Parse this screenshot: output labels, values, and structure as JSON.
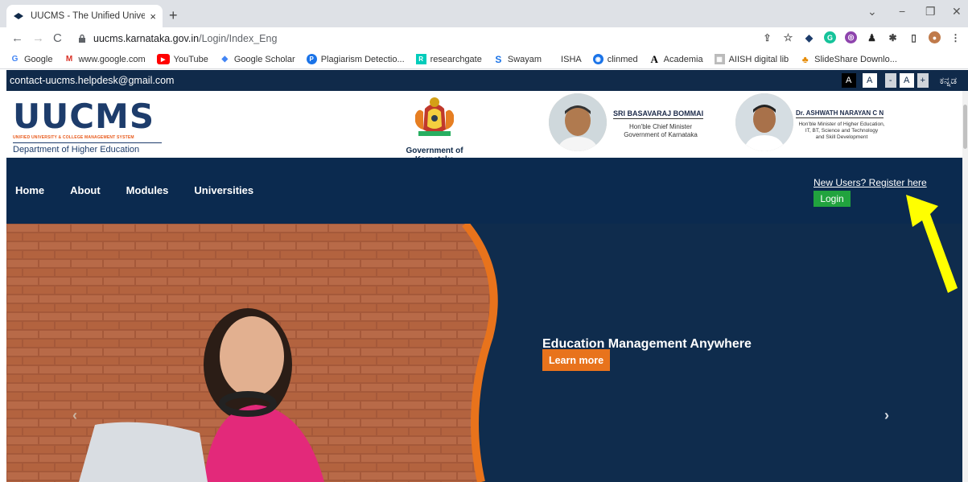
{
  "browser": {
    "tab_title": "UUCMS - The Unified University",
    "tab_close": "×",
    "new_tab": "+",
    "url_host": "uucms.karnataka.gov.in",
    "url_path": "/Login/Index_Eng",
    "bookmarks": [
      {
        "label": "Google",
        "icon": "google-icon",
        "color": "#4285f4"
      },
      {
        "label": "www.google.com",
        "icon": "gmail-icon",
        "color": "#d93025"
      },
      {
        "label": "YouTube",
        "icon": "youtube-icon",
        "color": "#ff0000"
      },
      {
        "label": "Google Scholar",
        "icon": "scholar-icon",
        "color": "#4285f4"
      },
      {
        "label": "Plagiarism Detectio...",
        "icon": "plagiarism-icon",
        "color": "#1a73e8"
      },
      {
        "label": "researchgate",
        "icon": "researchgate-icon",
        "color": "#00ccbb"
      },
      {
        "label": "Swayam",
        "icon": "swayam-icon",
        "color": "#1a73e8"
      },
      {
        "label": "ISHA",
        "icon": "",
        "color": "#333333"
      },
      {
        "label": "clinmed",
        "icon": "clinmed-icon",
        "color": "#1a73e8"
      },
      {
        "label": "Academia",
        "icon": "academia-icon",
        "color": "#000000"
      },
      {
        "label": "AIISH digital lib",
        "icon": "aiish-icon",
        "color": "#7a7a7a"
      },
      {
        "label": "SlideShare Downlo...",
        "icon": "slideshare-icon",
        "color": "#e68a00"
      }
    ]
  },
  "site": {
    "contact": "contact-uucms.helpdesk@gmail.com",
    "font_controls": [
      "A",
      "A",
      "-",
      "A",
      "+"
    ],
    "language_link": "ಕನ್ನಡ",
    "logo_text": "UUCMS",
    "logo_subtext": "UNIFIED UNIVERSITY & COLLEGE MANAGEMENT SYSTEM",
    "logo_dept": "Department of Higher Education",
    "gov_label": "Government of Karnataka",
    "cm": {
      "name": "SRI BASAVARAJ BOMMAI",
      "title1": "Hon'ble Chief Minister",
      "title2": "Government of Karnataka"
    },
    "minister": {
      "name": "Dr. ASHWATH NARAYAN C N",
      "title1": "Hon'ble Minister of Higher Education,",
      "title2": "IT, BT, Science and Technology",
      "title3": "and Skill Development"
    },
    "nav": [
      "Home",
      "About",
      "Modules",
      "Universities"
    ],
    "register_link": "New Users? Register here",
    "login_button": "Login",
    "hero_title": "Education Management Anywhere",
    "learn_more": "Learn more",
    "carousel_next": "›",
    "carousel_prev": "‹"
  },
  "colors": {
    "navy": "#0b2a4f",
    "login_green": "#21a33e",
    "accent_orange": "#e8731c",
    "annotation_arrow": "#ffff00"
  }
}
